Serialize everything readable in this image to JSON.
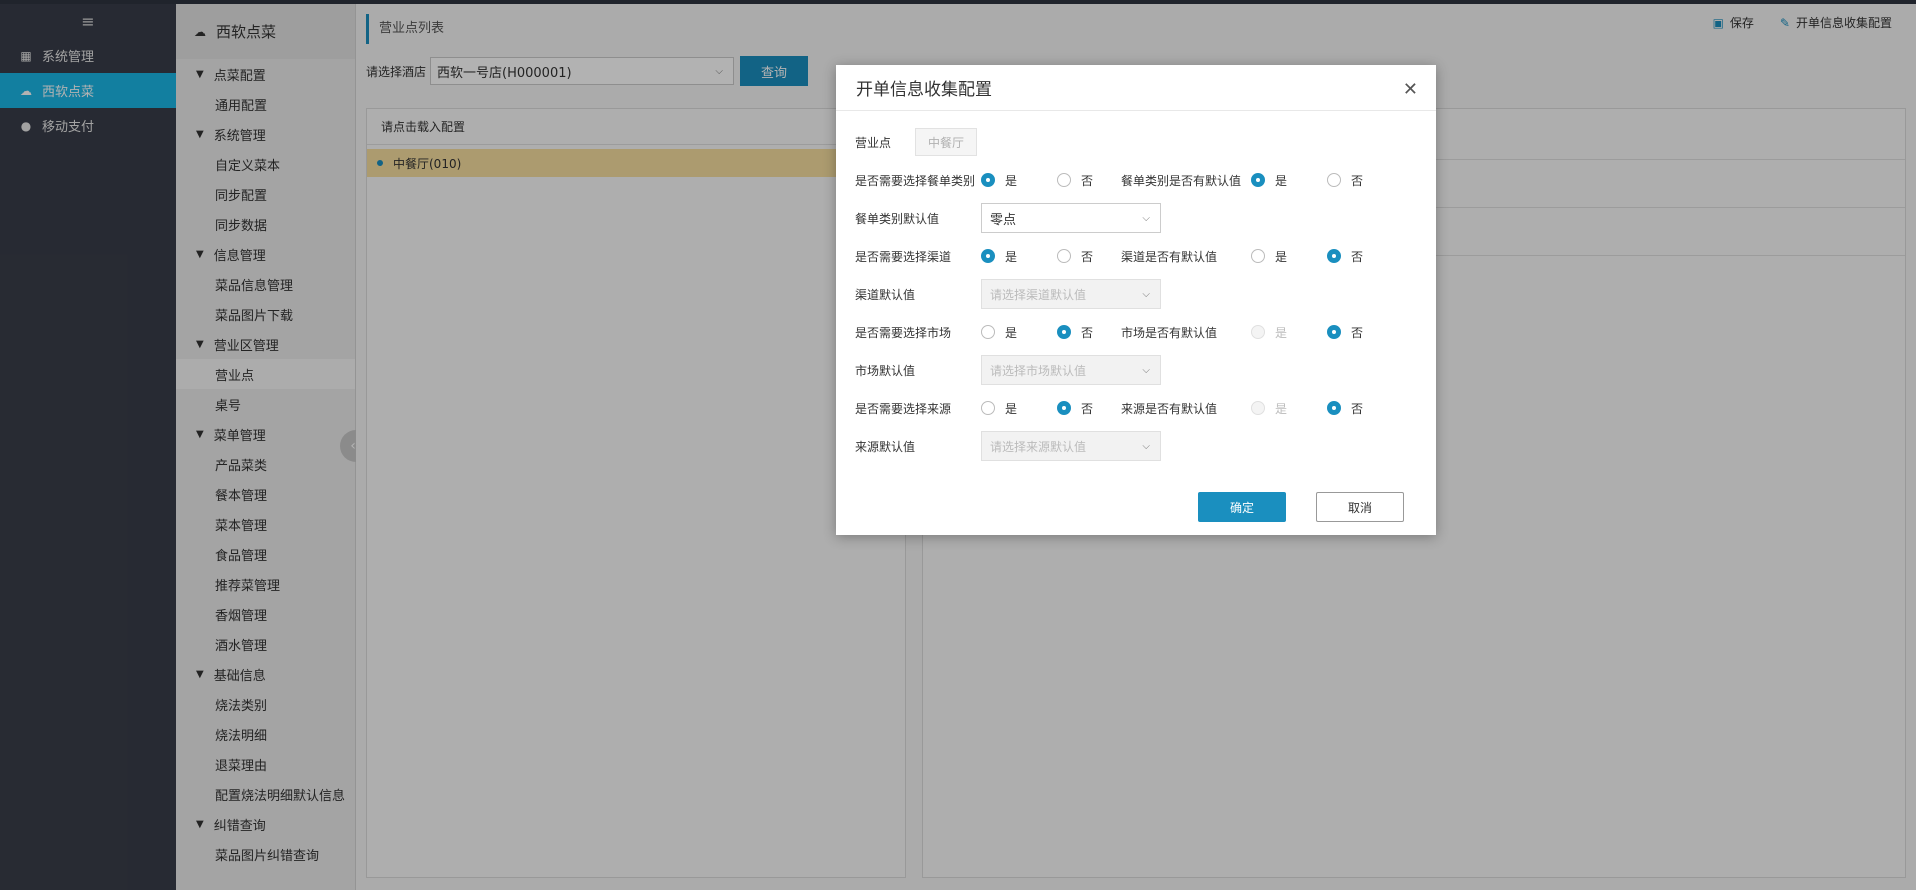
{
  "leftnav": {
    "items": [
      {
        "label": "系统管理",
        "icon": "grid-icon"
      },
      {
        "label": "西软点菜",
        "icon": "cloud-icon",
        "active": true
      },
      {
        "label": "移动支付",
        "icon": "payment-icon"
      }
    ]
  },
  "subnav": {
    "title": "西软点菜",
    "groups": [
      {
        "label": "点菜配置",
        "items": [
          "通用配置"
        ]
      },
      {
        "label": "系统管理",
        "items": [
          "自定义菜本",
          "同步配置",
          "同步数据"
        ]
      },
      {
        "label": "信息管理",
        "items": [
          "菜品信息管理",
          "菜品图片下载"
        ]
      },
      {
        "label": "营业区管理",
        "items": [
          "营业点",
          "桌号"
        ]
      },
      {
        "label": "菜单管理",
        "items": [
          "产品菜类",
          "餐本管理",
          "菜本管理",
          "食品管理",
          "推荐菜管理",
          "香烟管理",
          "酒水管理"
        ]
      },
      {
        "label": "基础信息",
        "items": [
          "烧法类别",
          "烧法明细",
          "退菜理由",
          "配置烧法明细默认信息"
        ]
      },
      {
        "label": "纠错查询",
        "items": [
          "菜品图片纠错查询"
        ]
      }
    ]
  },
  "main": {
    "page_title": "营业点列表",
    "toolbar": {
      "save": "保存",
      "config": "开单信息收集配置"
    },
    "filter": {
      "label": "请选择酒店",
      "value": "西软一号店(H000001)",
      "query": "查询"
    },
    "left_panel": {
      "header": "请点击载入配置",
      "row": "中餐厅(010)"
    }
  },
  "modal": {
    "title": "开单信息收集配置",
    "outlet_label": "营业点",
    "outlet_value": "中餐厅",
    "yes": "是",
    "no": "否",
    "rows": {
      "meal_need": "是否需要选择餐单类别",
      "meal_default_q": "餐单类别是否有默认值",
      "meal_default_label": "餐单类别默认值",
      "meal_default_value": "零点",
      "channel_need": "是否需要选择渠道",
      "channel_default_q": "渠道是否有默认值",
      "channel_default_label": "渠道默认值",
      "channel_placeholder": "请选择渠道默认值",
      "market_need": "是否需要选择市场",
      "market_default_q": "市场是否有默认值",
      "market_default_label": "市场默认值",
      "market_placeholder": "请选择市场默认值",
      "source_need": "是否需要选择来源",
      "source_default_q": "来源是否有默认值",
      "source_default_label": "来源默认值",
      "source_placeholder": "请选择来源默认值"
    },
    "ok": "确定",
    "cancel": "取消"
  }
}
